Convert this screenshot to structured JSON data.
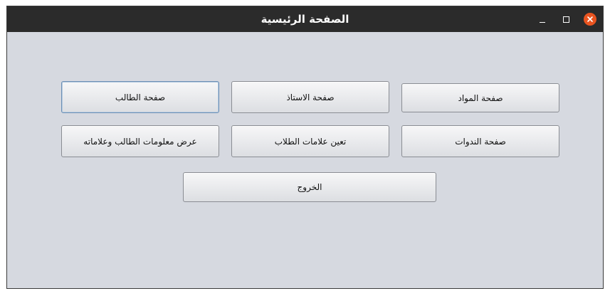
{
  "window": {
    "title": "الصفحة الرئيسية",
    "controls": {
      "minimize_icon": "minimize-icon",
      "maximize_icon": "maximize-icon",
      "close_icon": "close-icon",
      "close_color": "#e95420"
    }
  },
  "buttons": {
    "student_page": "صفحة الطالب",
    "teacher_page": "صفحة الاستاذ",
    "subjects_page": "صفحة المواد",
    "view_student_info": "عرض معلومات الطالب وعلاماته",
    "assign_grades": "تعين علامات الطلاب",
    "seminars_page": "صفحة الندوات",
    "exit": "الخروج"
  },
  "colors": {
    "titlebar": "#2b2b2b",
    "window_background": "#d6d9e0",
    "focus_border": "#6b8fb5"
  }
}
